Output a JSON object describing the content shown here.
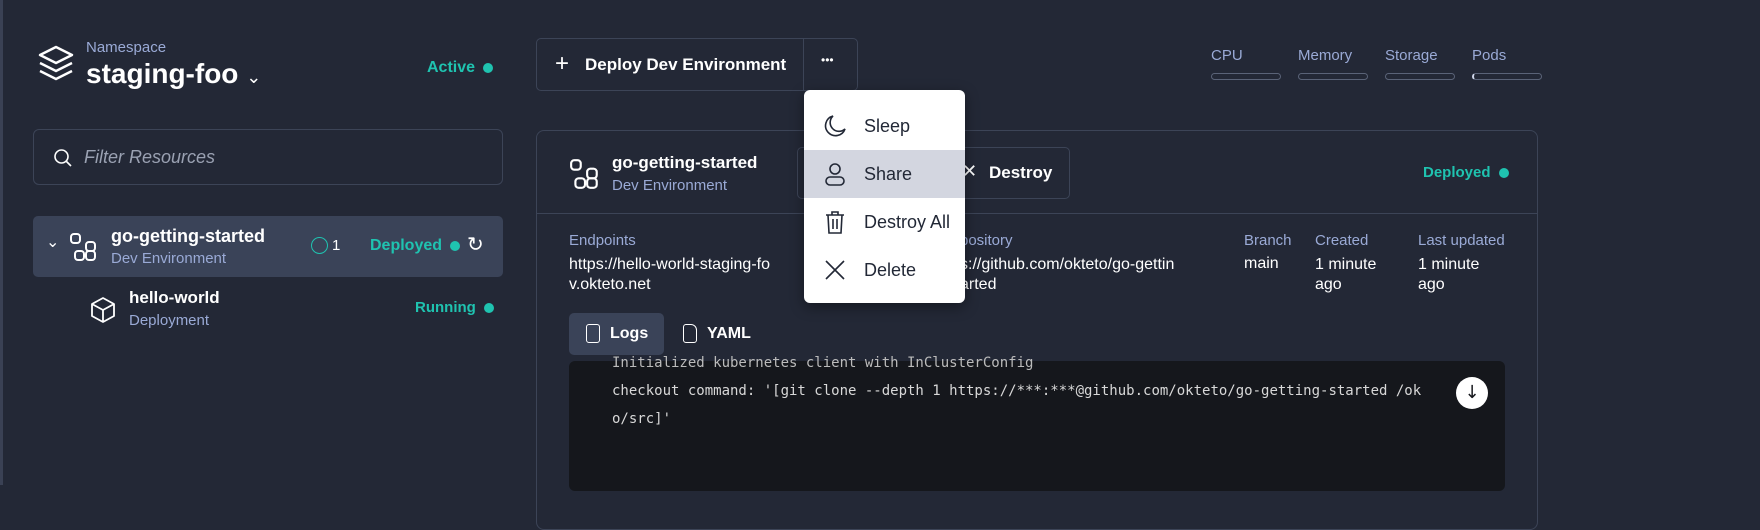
{
  "namespace": {
    "label": "Namespace",
    "name": "staging-foo",
    "status": "Active"
  },
  "filter": {
    "placeholder": "Filter Resources"
  },
  "tree": [
    {
      "name": "go-getting-started",
      "type": "Dev Environment",
      "count": "1",
      "status": "Deployed"
    },
    {
      "name": "hello-world",
      "type": "Deployment",
      "status": "Running"
    }
  ],
  "toolbar": {
    "deploy_label": "Deploy Dev Environment",
    "more": "•••"
  },
  "metrics": [
    {
      "label": "CPU",
      "value": 0
    },
    {
      "label": "Memory",
      "value": 0
    },
    {
      "label": "Storage",
      "value": 0
    },
    {
      "label": "Pods",
      "value": 0.03
    }
  ],
  "menu": {
    "items": [
      "Sleep",
      "Share",
      "Destroy All",
      "Delete"
    ],
    "highlighted": "Share"
  },
  "detail": {
    "name": "go-getting-started",
    "type": "Dev Environment",
    "destroy_label": "Destroy",
    "status": "Deployed",
    "endpoints_label": "Endpoints",
    "endpoints": "https://hello-world-staging-foo.okteto.dev.okteto.net",
    "endpoints_l1": "https://hello-world-staging-fo",
    "endpoints_l2": "v.okteto.net",
    "repo_label": "pository",
    "repo_l1": "s://github.com/okteto/go-gettin",
    "repo_l2": "arted",
    "branch_label": "Branch",
    "branch": "main",
    "created_label": "Created",
    "created": "1 minute ago",
    "updated_label": "Last updated",
    "updated": "1 minute ago"
  },
  "tabs": [
    "Logs",
    "YAML"
  ],
  "logs": [
    "Initialized kubernetes client with InClusterConfig",
    "checkout command: '[git clone --depth 1 https://***:***@github.com/okteto/go-getting-started /ok",
    "o/src]'"
  ],
  "colors": {
    "accent": "#1fc3b0",
    "bg": "#232836"
  }
}
